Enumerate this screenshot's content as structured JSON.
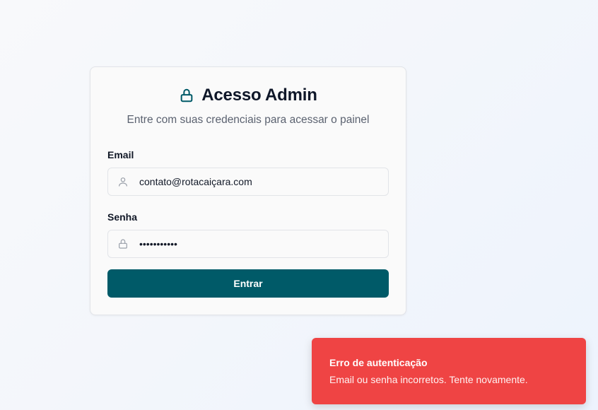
{
  "login": {
    "title": "Acesso Admin",
    "subtitle": "Entre com suas credenciais para acessar o painel",
    "title_icon": "lock-icon",
    "email_label": "Email",
    "email_value": "contato@rotacaiçara.com",
    "email_icon": "user-icon",
    "password_label": "Senha",
    "password_value": "•••••••••••",
    "password_icon": "lock-icon",
    "submit_label": "Entrar"
  },
  "toast": {
    "title": "Erro de autenticação",
    "message": "Email ou senha incorretos. Tente novamente."
  },
  "colors": {
    "primary": "#005a68",
    "error": "#ef4444",
    "text": "#0f1729",
    "muted": "#5b6270"
  }
}
